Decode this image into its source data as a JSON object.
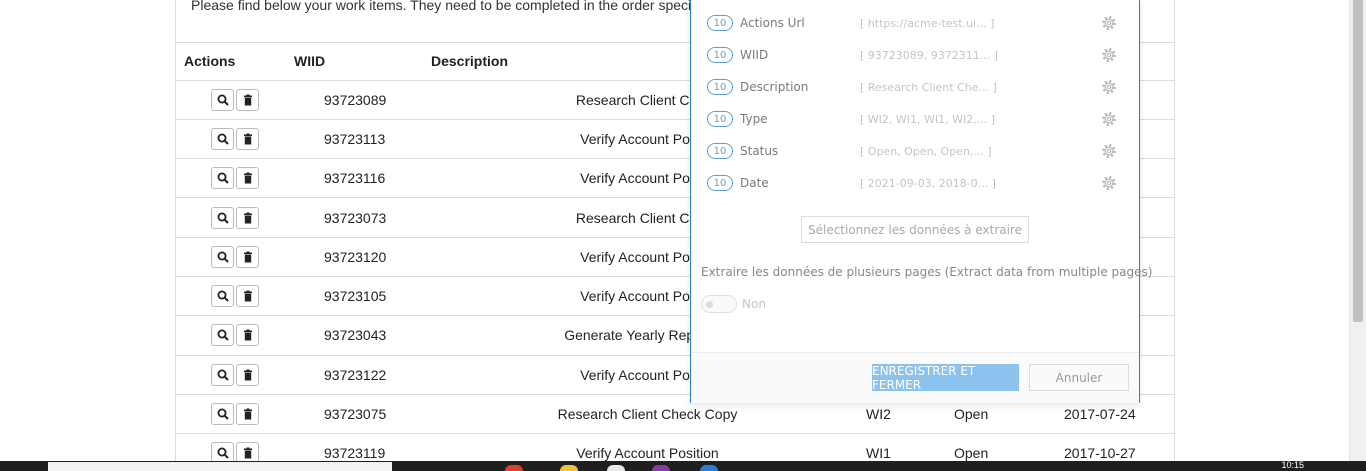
{
  "intro": "Please find below your work items. They need to be completed in the order speci",
  "table": {
    "headers": {
      "actions": "Actions",
      "wiid": "WIID",
      "description": "Description"
    },
    "rows": [
      {
        "wiid": "93723089",
        "description": "Research Client Check",
        "type": "",
        "status": "",
        "date": ""
      },
      {
        "wiid": "93723113",
        "description": "Verify Account Positio",
        "type": "",
        "status": "",
        "date": ""
      },
      {
        "wiid": "93723116",
        "description": "Verify Account Positio",
        "type": "",
        "status": "",
        "date": ""
      },
      {
        "wiid": "93723073",
        "description": "Research Client Check",
        "type": "",
        "status": "",
        "date": ""
      },
      {
        "wiid": "93723120",
        "description": "Verify Account Positio",
        "type": "",
        "status": "",
        "date": ""
      },
      {
        "wiid": "93723105",
        "description": "Verify Account Positio",
        "type": "",
        "status": "",
        "date": ""
      },
      {
        "wiid": "93723043",
        "description": "Generate Yearly Report for",
        "type": "",
        "status": "",
        "date": ""
      },
      {
        "wiid": "93723122",
        "description": "Verify Account Positio",
        "type": "",
        "status": "",
        "date": ""
      },
      {
        "wiid": "93723075",
        "description": "Research Client Check Copy",
        "type": "WI2",
        "status": "Open",
        "date": "2017-07-24"
      },
      {
        "wiid": "93723119",
        "description": "Verify Account Position",
        "type": "WI1",
        "status": "Open",
        "date": "2017-10-27"
      }
    ]
  },
  "dialog": {
    "fields": [
      {
        "count": "10",
        "name": "Actions Url",
        "preview": "[ https://acme-test.ui... ]"
      },
      {
        "count": "10",
        "name": "WIID",
        "preview": "[ 93723089, 9372311... ]"
      },
      {
        "count": "10",
        "name": "Description",
        "preview": "[ Research Client Che... ]"
      },
      {
        "count": "10",
        "name": "Type",
        "preview": "[ WI2, WI1, WI1, WI2,... ]"
      },
      {
        "count": "10",
        "name": "Status",
        "preview": "[ Open, Open, Open,... ]"
      },
      {
        "count": "10",
        "name": "Date",
        "preview": "[ 2021-09-03, 2018-0... ]"
      }
    ],
    "select_button": "Sélectionnez les données à extraire",
    "multi_page_label": "Extraire les données de plusieurs pages (Extract data from multiple pages)",
    "toggle_label": "Non",
    "save_button": "ENREGISTRER ET FERMER",
    "cancel_button": "Annuler"
  },
  "taskbar": {
    "clock": "10:15"
  },
  "colors": {
    "accent": "#2f7fd1",
    "primary_button": "#8cc2ee",
    "count_badge": "#5aa0d6"
  },
  "icons": {
    "view": "search-icon",
    "delete": "trash-icon",
    "settings": "gear-icon"
  }
}
